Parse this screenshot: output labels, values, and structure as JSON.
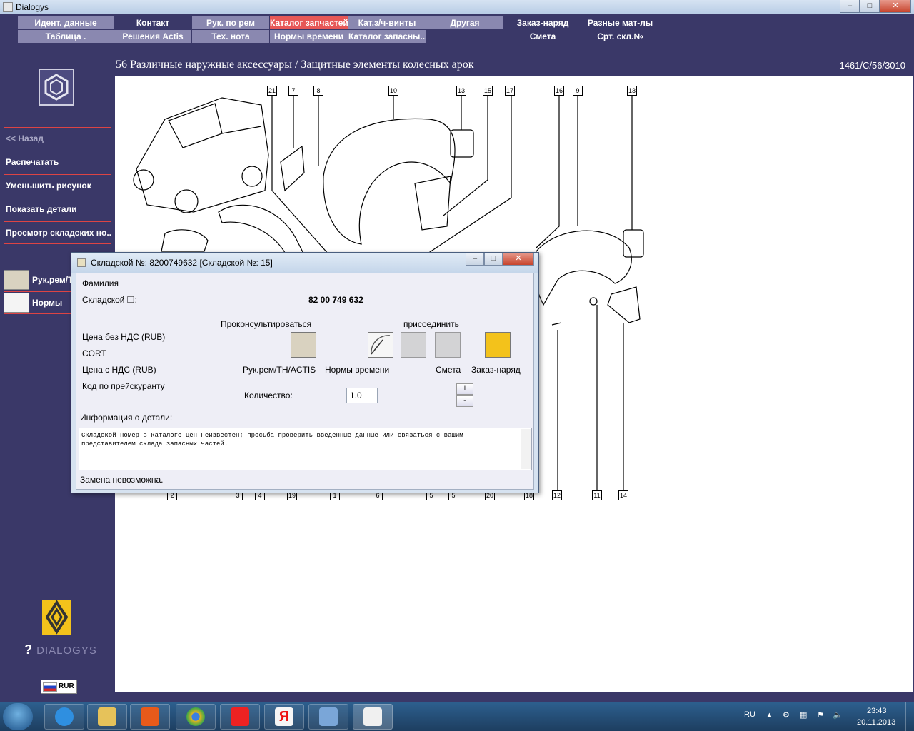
{
  "window": {
    "title": "Dialogys"
  },
  "menu": {
    "row1": [
      "Идент. данные",
      "Контакт",
      "Рук. по рем",
      "Каталог запчастей",
      "Кат.з/ч-винты",
      "Другая",
      "Заказ-наряд",
      "Разные мат-лы"
    ],
    "row2": [
      "Таблица .",
      "Решения Actis",
      "Тех. нота",
      "Нормы времени",
      "Каталог запасны...",
      "Смета",
      "Срт. скл.№"
    ]
  },
  "sidebar": {
    "back": "<< Назад",
    "items": [
      "Распечатать",
      "Уменьшить рисунок",
      "Показать детали",
      "Просмотр складских но..."
    ],
    "tools": [
      "Рук.рем/Т",
      "Нормы"
    ],
    "brand": "DIALOGYS",
    "currency": "RUR"
  },
  "main": {
    "heading": "56 Различные наружные аксессуары / Защитные элементы колесных арок",
    "reference": "1461/C/56/3010"
  },
  "diagram": {
    "callouts_top": [
      "21",
      "7",
      "8",
      "10",
      "13",
      "15",
      "17",
      "16",
      "9",
      "13"
    ],
    "callouts_bottom": [
      "2",
      "3",
      "4",
      "19",
      "1",
      "6",
      "5",
      "5",
      "20",
      "18",
      "12",
      "11",
      "14"
    ]
  },
  "dialog": {
    "title": "Складской №: 8200749632 [Складской №: 15]",
    "family_label": "Фамилия",
    "part_label": "Складской ❏:",
    "part_value": "82 00 749 632",
    "consult_label": "Проконсультироваться",
    "attach_label": "присоединить",
    "price_no_vat": "Цена без НДС (RUB)",
    "cort": "CORT",
    "price_vat": "Цена с НДС (RUB)",
    "price_code": "Код по прейскуранту",
    "tool_labels": [
      "Рук.рем/TH/ACTIS",
      "Нормы времени",
      "Смета",
      "Заказ-наряд"
    ],
    "qty_label": "Количество:",
    "qty_value": "1.0",
    "plus": "+",
    "minus": "-",
    "info_label": "Информация о детали:",
    "info_text": "Складской номер в каталоге цен неизвестен; просьба проверить введенные данные или связаться с вашим представителем склада запасных частей.",
    "status": "Замена невозможна."
  },
  "taskbar": {
    "lang": "RU",
    "time": "23:43",
    "date": "20.11.2013"
  }
}
